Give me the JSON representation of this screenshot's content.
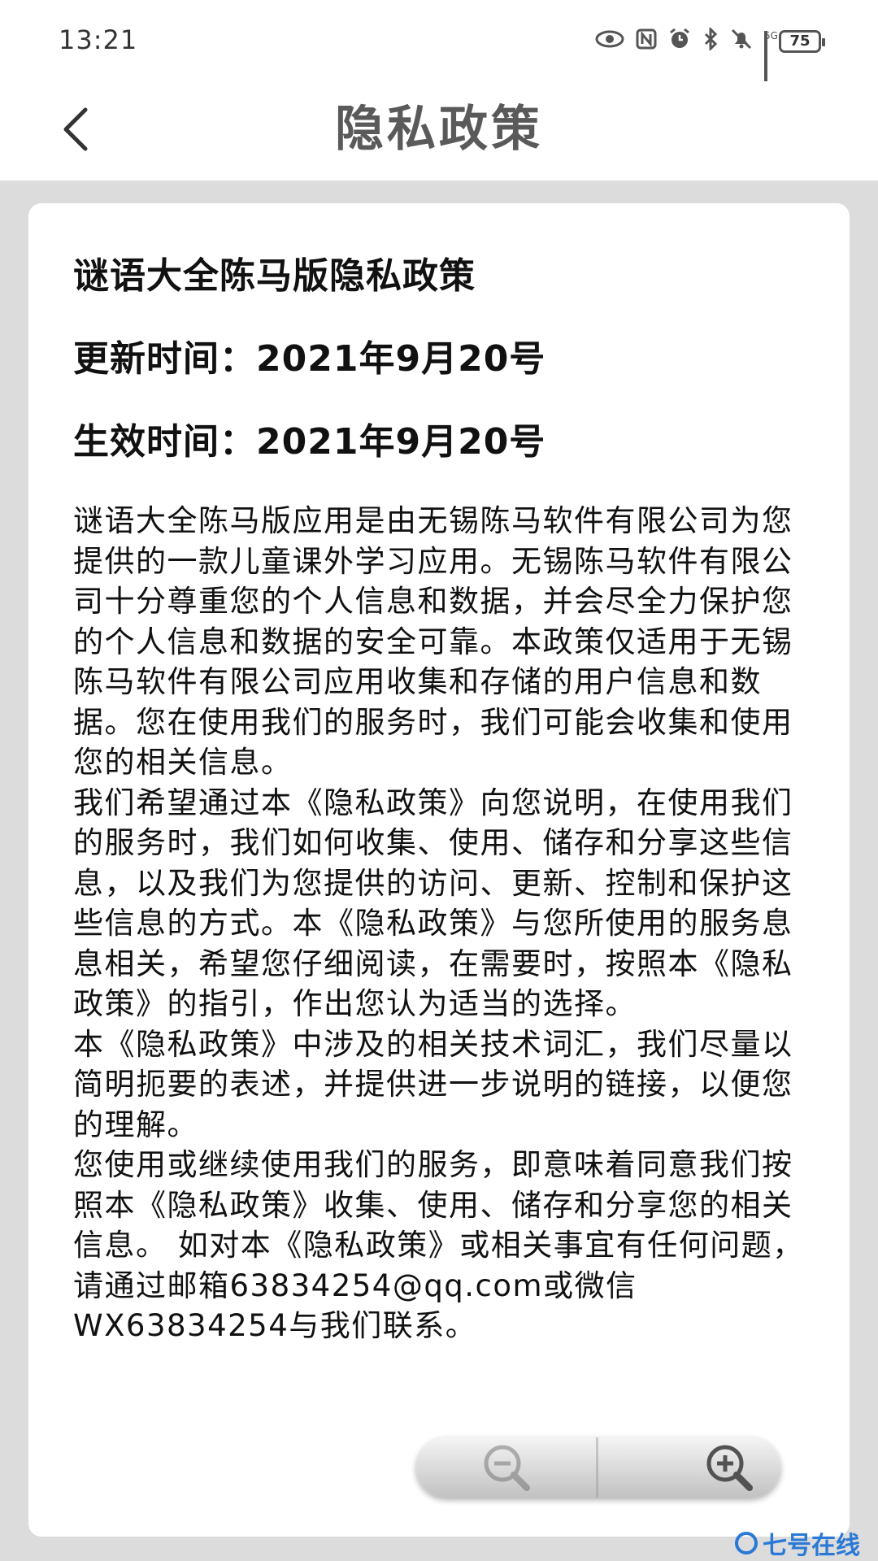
{
  "status_bar": {
    "time": "13:21",
    "network": "5G",
    "battery": "75",
    "icons": [
      "eye-icon",
      "nfc-icon",
      "alarm-icon",
      "bluetooth-icon",
      "mute-icon",
      "signal-icon",
      "battery-icon"
    ]
  },
  "header": {
    "back_icon": "chevron-left-icon",
    "title": "隐私政策"
  },
  "document": {
    "heading": "谜语大全陈马版隐私政策",
    "updated": "更新时间：2021年9月20号",
    "effective": "生效时间：2021年9月20号",
    "body": "谜语大全陈马版应用是由无锡陈马软件有限公司为您提供的一款儿童课外学习应用。无锡陈马软件有限公司十分尊重您的个人信息和数据，并会尽全力保护您的个人信息和数据的安全可靠。本政策仅适用于无锡陈马软件有限公司应用收集和存储的用户信息和数据。您在使用我们的服务时，我们可能会收集和使用您的相关信息。\n我们希望通过本《隐私政策》向您说明，在使用我们的服务时，我们如何收集、使用、储存和分享这些信息，以及我们为您提供的访问、更新、控制和保护这些信息的方式。本《隐私政策》与您所使用的服务息息相关，希望您仔细阅读，在需要时，按照本《隐私政策》的指引，作出您认为适当的选择。\n本《隐私政策》中涉及的相关技术词汇，我们尽量以简明扼要的表述，并提供进一步说明的链接，以便您的理解。\n您使用或继续使用我们的服务，即意味着同意我们按照本《隐私政策》收集、使用、储存和分享您的相关信息。 如对本《隐私政策》或相关事宜有任何问题，请通过邮箱63834254@qq.com或微信WX63834254与我们联系。"
  },
  "zoom": {
    "zoom_out_icon": "zoom-out-icon",
    "zoom_in_icon": "zoom-in-icon"
  },
  "watermark": {
    "text": "七号在线"
  },
  "colors": {
    "background": "#dcdcdc",
    "card": "#ffffff",
    "title_text": "#5a5a5a",
    "watermark": "#2a79d6"
  }
}
